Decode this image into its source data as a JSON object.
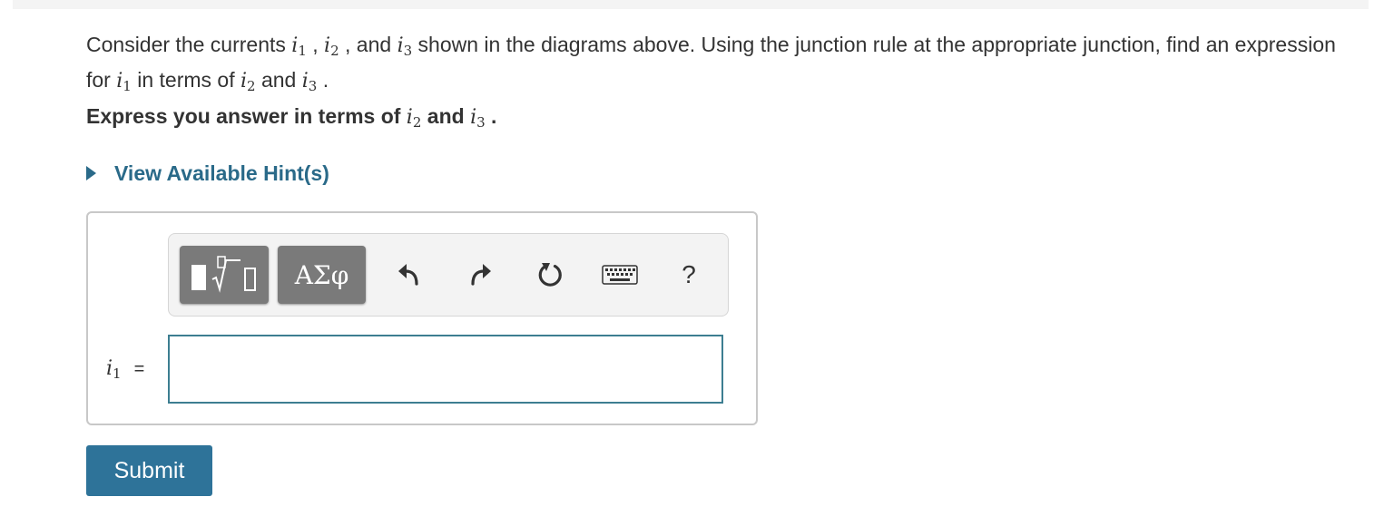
{
  "question": {
    "text_a": "Consider the currents ",
    "var1": "i",
    "sub1": "1",
    "sep1": " , ",
    "var2": "i",
    "sub2": "2",
    "text_b": " , and ",
    "var3": "i",
    "sub3": "3",
    "text_c": " shown in the diagrams above. Using the junction rule at the appropriate junction, find an expression for ",
    "var4": "i",
    "sub4": "1",
    "text_d": " in terms of ",
    "var5": "i",
    "sub5": "2",
    "text_e": " and ",
    "var6": "i",
    "sub6": "3",
    "text_f": " ."
  },
  "instruction": {
    "text_a": "Express you answer in terms of ",
    "var1": "i",
    "sub1": "2",
    "text_b": " and ",
    "var2": "i",
    "sub2": "3",
    "text_c": " ."
  },
  "hint": {
    "label": "View Available Hint(s)"
  },
  "toolbar": {
    "templates_icon": "templates-icon",
    "greek_label": "ΑΣφ",
    "undo_icon": "undo-icon",
    "redo_icon": "redo-icon",
    "reset_icon": "reset-icon",
    "keyboard_icon": "keyboard-icon",
    "help_label": "?"
  },
  "answer": {
    "var": "i",
    "sub": "1",
    "equals": "=",
    "value": ""
  },
  "submit": {
    "label": "Submit"
  },
  "colors": {
    "link": "#2a6a89",
    "button": "#2e7399",
    "input_border": "#3d7e91",
    "toolbar_button": "#7a7a7a"
  }
}
